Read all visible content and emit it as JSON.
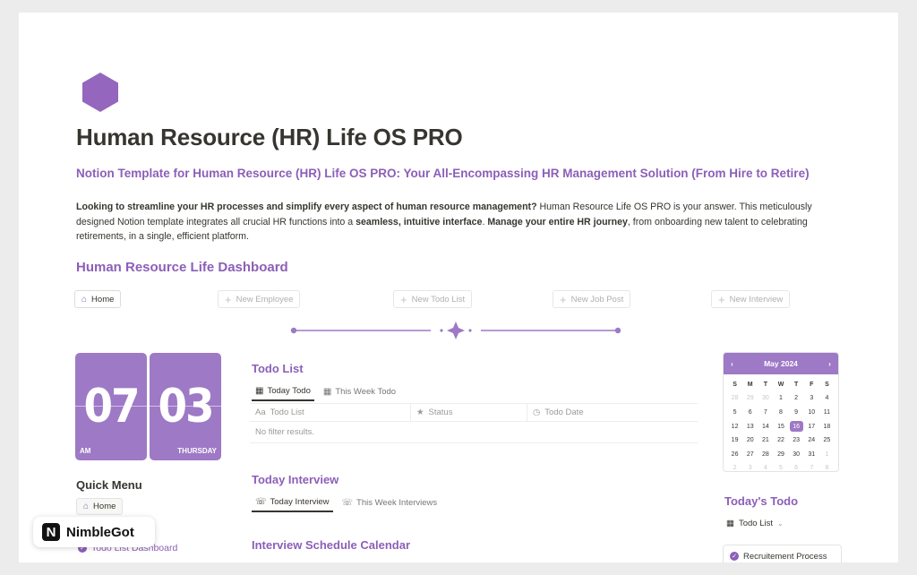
{
  "page": {
    "title": "Human Resource (HR) Life OS PRO",
    "subtitle": "Notion Template for Human Resource (HR) Life OS PRO: Your All-Encompassing HR Management Solution (From Hire to Retire)",
    "description": {
      "p1_bold": "Looking to streamline your HR processes and simplify every aspect of human resource management?",
      "p1_normal": " Human Resource Life OS PRO is your answer. This meticulously designed Notion template integrates all crucial HR functions into a ",
      "p2_bold": "seamless, intuitive interface",
      "p2_sep": ". ",
      "p3_bold": "Manage your entire HR journey",
      "p3_normal": ", from onboarding new talent to celebrating retirements, in a single, efficient platform."
    },
    "accent_color": "#8c5fb8",
    "icon": "hexagon-icon"
  },
  "dashboard": {
    "title": "Human Resource Life Dashboard",
    "buttons": {
      "home": "Home",
      "new_employee": "New Employee",
      "new_todo_list": "New Todo List",
      "new_job_post": "New Job Post",
      "new_interview": "New Interview"
    }
  },
  "clock": {
    "hour": "07",
    "minute": "03",
    "period": "AM",
    "weekday": "THURSDAY"
  },
  "quick_menu": {
    "title": "Quick Menu",
    "home": "Home",
    "link": "Todo List Dashboard"
  },
  "todo_list": {
    "title": "Todo List",
    "tabs": [
      "Today Todo",
      "This Week Todo"
    ],
    "columns": [
      "Todo List",
      "Status",
      "Todo Date"
    ],
    "empty": "No filter results."
  },
  "interview": {
    "title": "Today Interview",
    "tabs": [
      "Today Interview",
      "This Week Interviews"
    ],
    "calendar_title": "Interview Schedule Calendar"
  },
  "calendar": {
    "month": "May 2024",
    "prev": "‹",
    "next": "›",
    "weekdays": [
      "S",
      "M",
      "T",
      "W",
      "T",
      "F",
      "S"
    ],
    "days": [
      [
        "28",
        "muted"
      ],
      [
        "29",
        "muted"
      ],
      [
        "30",
        "muted"
      ],
      [
        "1",
        ""
      ],
      [
        "2",
        ""
      ],
      [
        "3",
        ""
      ],
      [
        "4",
        ""
      ],
      [
        "5",
        ""
      ],
      [
        "6",
        ""
      ],
      [
        "7",
        ""
      ],
      [
        "8",
        ""
      ],
      [
        "9",
        ""
      ],
      [
        "10",
        ""
      ],
      [
        "11",
        ""
      ],
      [
        "12",
        ""
      ],
      [
        "13",
        ""
      ],
      [
        "14",
        ""
      ],
      [
        "15",
        ""
      ],
      [
        "16",
        "today"
      ],
      [
        "17",
        ""
      ],
      [
        "18",
        ""
      ],
      [
        "19",
        ""
      ],
      [
        "20",
        ""
      ],
      [
        "21",
        ""
      ],
      [
        "22",
        ""
      ],
      [
        "23",
        ""
      ],
      [
        "24",
        ""
      ],
      [
        "25",
        ""
      ],
      [
        "26",
        ""
      ],
      [
        "27",
        ""
      ],
      [
        "28",
        ""
      ],
      [
        "29",
        ""
      ],
      [
        "30",
        ""
      ],
      [
        "31",
        ""
      ],
      [
        "1",
        "muted"
      ],
      [
        "2",
        "muted"
      ],
      [
        "3",
        "muted"
      ],
      [
        "4",
        "muted"
      ],
      [
        "5",
        "muted"
      ],
      [
        "6",
        "muted"
      ],
      [
        "7",
        "muted"
      ],
      [
        "8",
        "muted"
      ]
    ]
  },
  "todays_todo": {
    "title": "Today's Todo",
    "view": "Todo List",
    "card": "Recruitement Process"
  },
  "badge": {
    "logo": "N",
    "name": "NimbleGot"
  }
}
